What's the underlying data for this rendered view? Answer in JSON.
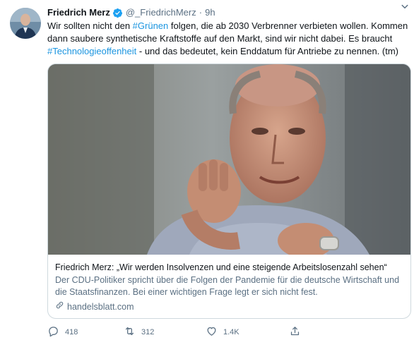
{
  "tweet": {
    "display_name": "Friedrich Merz",
    "handle": "@_FriedrichMerz",
    "separator": "·",
    "time": "9h",
    "text": {
      "part1": "Wir sollten nicht den ",
      "hashtag1": "#Grünen",
      "part2": " folgen, die ab 2030 Verbrenner verbieten wollen. Kommen dann saubere synthetische Kraftstoffe auf den Markt, sind wir nicht dabei. Es braucht ",
      "hashtag2": "#Technologieoffenheit",
      "part3": " - und das bedeutet, kein Enddatum für Antriebe zu nennen. (tm)"
    }
  },
  "card": {
    "title": "Friedrich Merz: „Wir werden Insolvenzen und eine steigende Arbeitslosenzahl sehen“",
    "description": "Der CDU-Politiker spricht über die Folgen der Pandemie für die deutsche Wirtschaft und die Staatsfinanzen. Bei einer wichtigen Frage legt er sich nicht fest.",
    "domain": "handelsblatt.com"
  },
  "actions": {
    "replies": "418",
    "retweets": "312",
    "likes": "1.4K"
  },
  "colors": {
    "hashtag": "#1b95e0",
    "secondary_text": "#5b7083",
    "verified_badge": "#1da1f2",
    "card_border": "#cfd9de"
  },
  "icons": [
    "verified-badge-icon",
    "caret-down-icon",
    "link-icon",
    "reply-icon",
    "retweet-icon",
    "like-icon",
    "share-icon"
  ]
}
